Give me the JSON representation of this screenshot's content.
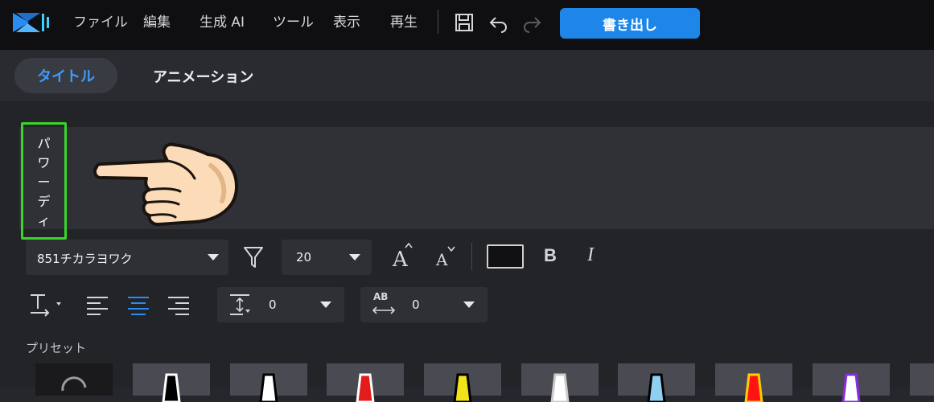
{
  "menu": {
    "items": [
      "ファイル",
      "編集",
      "生成 AI",
      "ツール",
      "表示",
      "再生"
    ],
    "export_label": "書き出し"
  },
  "tabs": {
    "title": "タイトル",
    "animation": "アニメーション"
  },
  "editor": {
    "vertical_text": "パ\nワ\nー\nデ\nィ"
  },
  "font": {
    "family_value": "851チカラヨワク",
    "size_value": "20"
  },
  "style": {
    "bold_label": "B",
    "italic_label": "I"
  },
  "spacing": {
    "line_spacing_value": "0",
    "char_spacing_label": "AB",
    "char_spacing_value": "0"
  },
  "presets": {
    "label": "プリセット",
    "swatch_colors": [
      "#000000",
      "#ffffff",
      "#e21b1b",
      "#f2e21a",
      "#ffffff",
      "#8fd0f2",
      "#ff1414",
      "#ffffff"
    ],
    "swatch_outline_colors": [
      "#ffffff",
      "#000000",
      "#ffffff",
      "#000000",
      "#cccccc",
      "#000000",
      "#ffd000",
      "#8a2be2"
    ]
  },
  "colors": {
    "accent": "#1e86e8",
    "highlight_border": "#39d62a"
  }
}
